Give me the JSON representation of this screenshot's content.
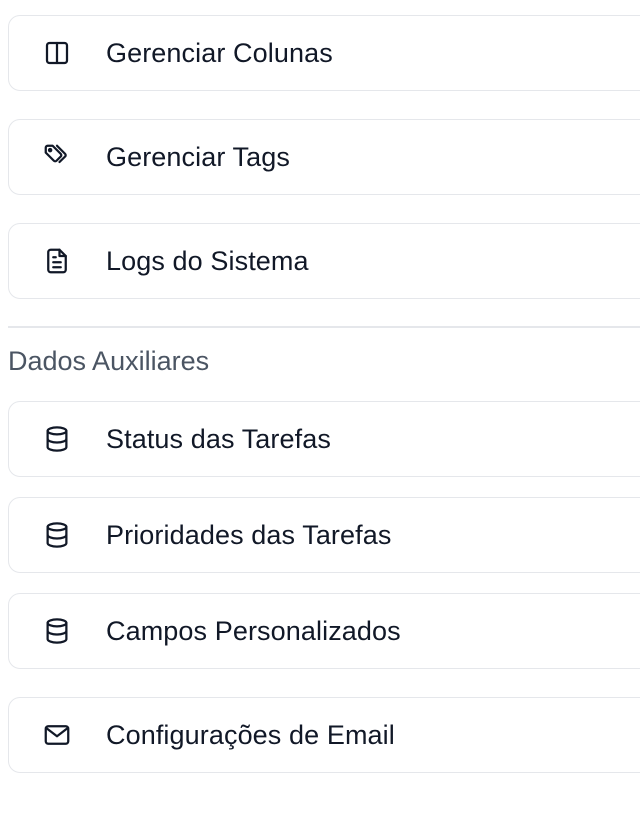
{
  "top_items": [
    {
      "label": "Gerenciar Colunas",
      "icon": "columns-icon"
    },
    {
      "label": "Gerenciar Tags",
      "icon": "tags-icon"
    },
    {
      "label": "Logs do Sistema",
      "icon": "file-text-icon"
    }
  ],
  "auxiliary": {
    "title": "Dados Auxiliares",
    "items": [
      {
        "label": "Status das Tarefas",
        "icon": "database-icon"
      },
      {
        "label": "Prioridades das Tarefas",
        "icon": "database-icon"
      },
      {
        "label": "Campos Personalizados",
        "icon": "database-icon"
      },
      {
        "label": "Configurações de Email",
        "icon": "mail-icon"
      }
    ]
  },
  "colors": {
    "text": "#111827",
    "muted_text": "#4b5563",
    "border": "#e5e7eb",
    "background": "#ffffff"
  }
}
